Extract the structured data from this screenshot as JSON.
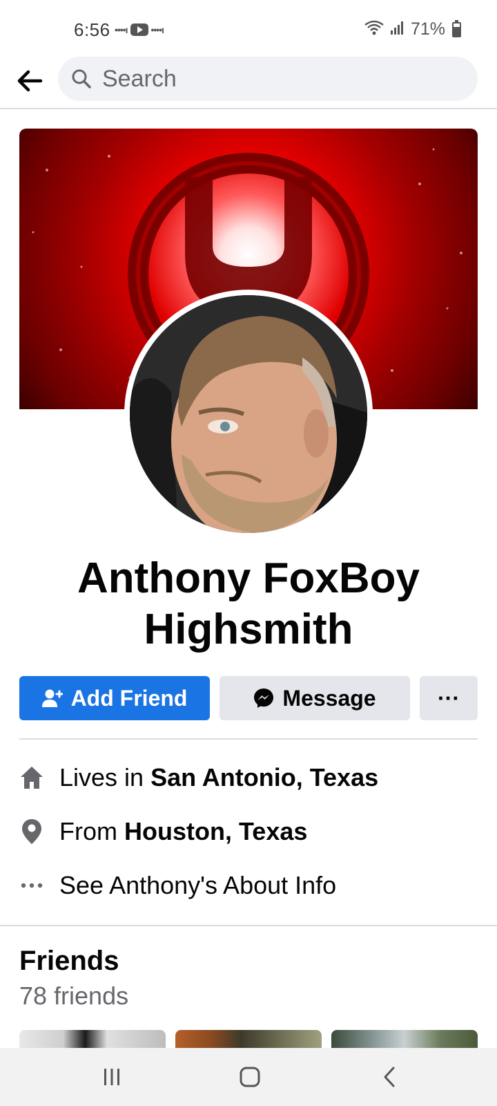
{
  "status_bar": {
    "time": "6:56",
    "battery": "71%",
    "icons": [
      "signal-dots-icon",
      "youtube-icon",
      "wifi-icon",
      "cell-signal-icon",
      "battery-icon"
    ]
  },
  "header": {
    "back_icon": "arrow-left-icon",
    "search_placeholder": "Search",
    "search_icon": "search-icon"
  },
  "profile": {
    "name": "Anthony FoxBoy Highsmith",
    "cover_theme_colors": [
      "#ff0000",
      "#8b0000",
      "#ffffff"
    ]
  },
  "actions": {
    "add_friend": "Add Friend",
    "message": "Message",
    "more": "···"
  },
  "about": {
    "lives_prefix": "Lives in ",
    "lives_place": "San Antonio, Texas",
    "from_prefix": "From ",
    "from_place": "Houston, Texas",
    "see_about": "See Anthony's About Info"
  },
  "friends": {
    "title": "Friends",
    "count": "78 friends"
  },
  "nav": {
    "recent_icon": "recent-apps-icon",
    "home_icon": "home-icon",
    "back_icon": "back-chevron-icon"
  },
  "colors": {
    "primary": "#1b74e4",
    "secondary_button": "#e4e6eb",
    "search_bg": "#f0f2f5",
    "muted_text": "#65676b"
  }
}
